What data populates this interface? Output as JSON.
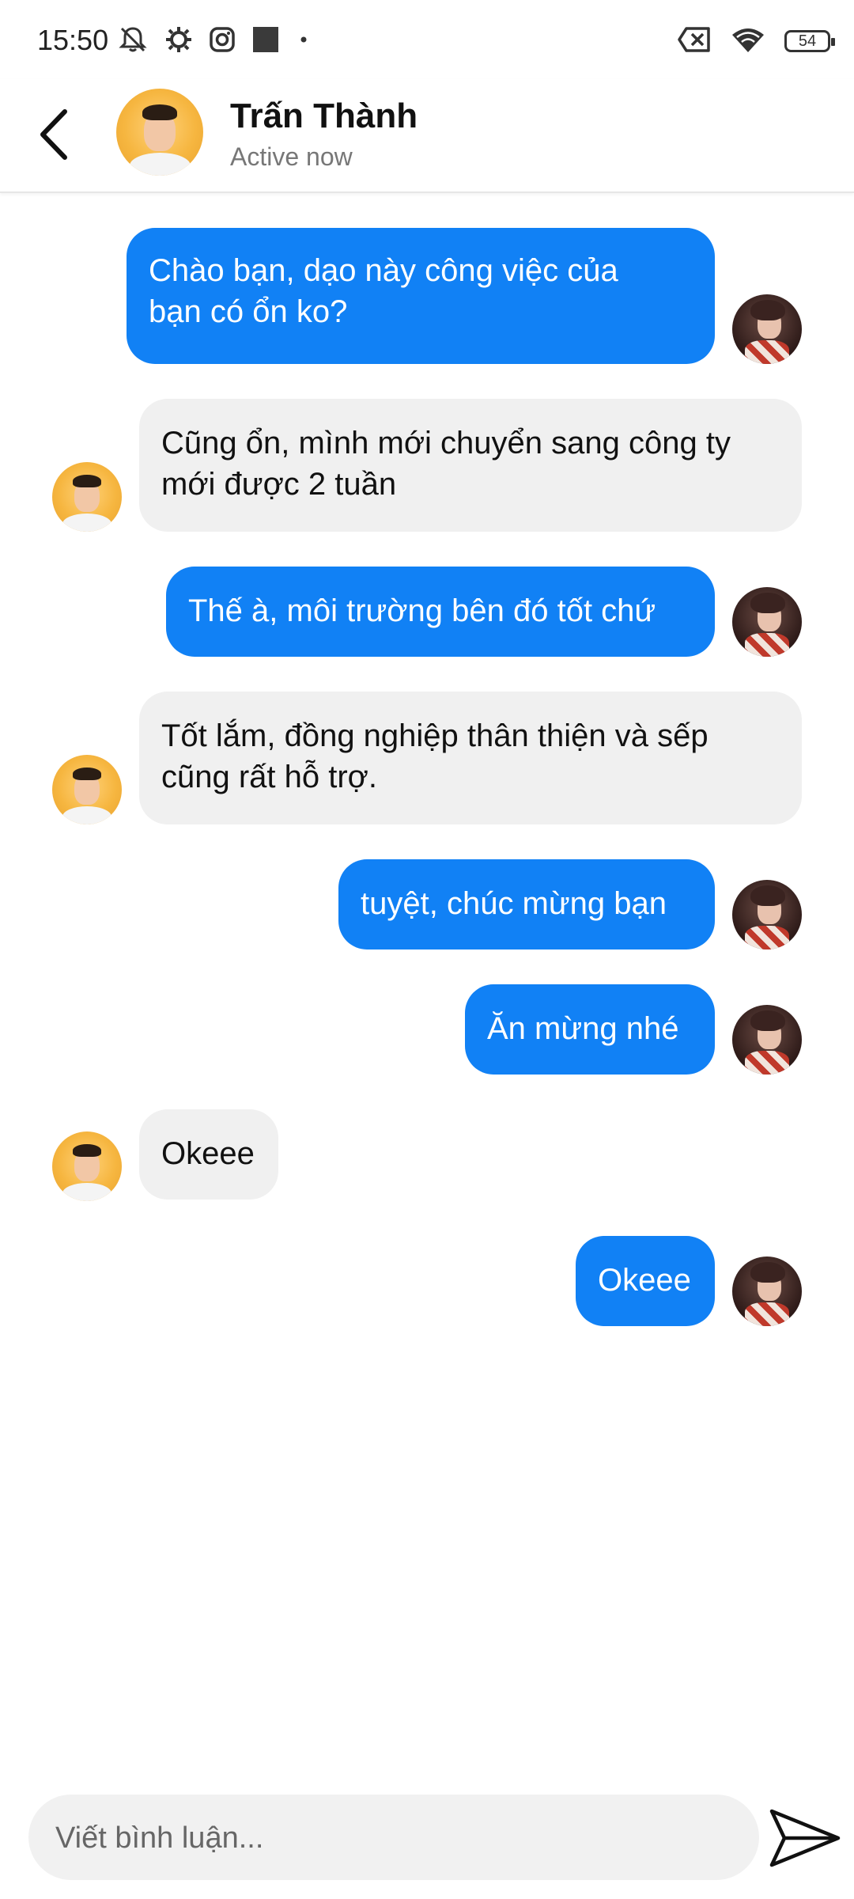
{
  "status_bar": {
    "time": "15:50",
    "left_icons": [
      "muted-bell-icon",
      "gear-icon",
      "instagram-icon",
      "square-app-icon",
      "dot-icon"
    ],
    "right_icons": [
      "no-sim-icon",
      "wifi-icon",
      "battery-icon"
    ],
    "battery_level": "54"
  },
  "header": {
    "name": "Trấn Thành",
    "status": "Active now"
  },
  "messages": [
    {
      "from": "me",
      "lines": [
        "Chào bạn, dạo này công việc của",
        "bạn có ổn ko?"
      ]
    },
    {
      "from": "contact",
      "lines": [
        "Cũng ổn, mình mới chuyển sang công ty",
        "mới được 2 tuần"
      ]
    },
    {
      "from": "me",
      "lines": [
        "Thế à, môi trường bên đó tốt chứ"
      ]
    },
    {
      "from": "contact",
      "lines": [
        "Tốt lắm, đồng nghiệp thân thiện và sếp",
        "cũng rất hỗ trợ."
      ]
    },
    {
      "from": "me",
      "lines": [
        "tuyệt, chúc mừng bạn"
      ]
    },
    {
      "from": "me",
      "lines": [
        "Ăn mừng nhé"
      ]
    },
    {
      "from": "contact",
      "lines": [
        "Okeee"
      ]
    },
    {
      "from": "me",
      "lines": [
        "Okeee"
      ]
    }
  ],
  "composer": {
    "placeholder": "Viết bình luận..."
  },
  "colors": {
    "outgoing_bubble": "#1181f5",
    "incoming_bubble": "#f0f0f0"
  }
}
